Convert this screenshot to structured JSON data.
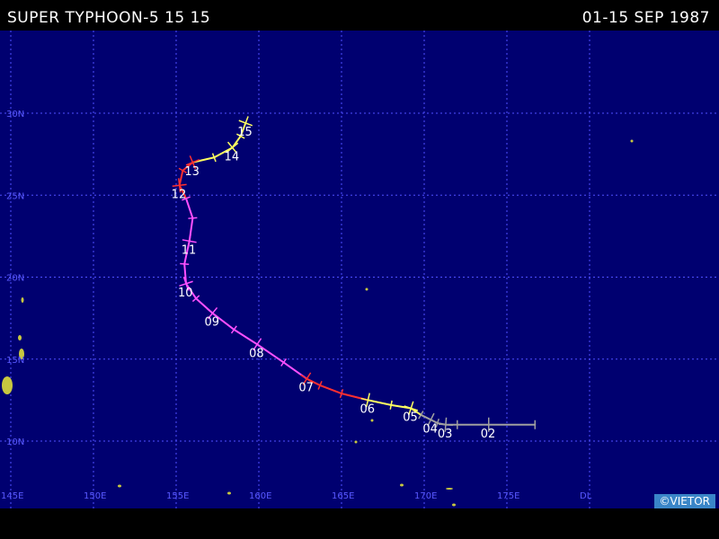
{
  "header": {
    "title": "SUPER TYPHOON-5 15 15",
    "date_range": "01-15 SEP 1987"
  },
  "map": {
    "ocean_color": "#000070",
    "grid_color": "#4f4fff",
    "label_color": "#5a5aff",
    "lat_labels": [
      {
        "text": "10N",
        "lat": 10
      },
      {
        "text": "15N",
        "lat": 15
      },
      {
        "text": "20N",
        "lat": 20
      },
      {
        "text": "25N",
        "lat": 25
      },
      {
        "text": "30N",
        "lat": 30
      }
    ],
    "lon_labels": [
      {
        "text": "145E",
        "lon": 145
      },
      {
        "text": "150E",
        "lon": 150
      },
      {
        "text": "155E",
        "lon": 155
      },
      {
        "text": "160E",
        "lon": 160
      },
      {
        "text": "165E",
        "lon": 165
      },
      {
        "text": "170E",
        "lon": 170
      },
      {
        "text": "175E",
        "lon": 175
      },
      {
        "text": "DL",
        "lon": 180
      }
    ]
  },
  "track": {
    "stage_colors": {
      "depression": "#a0a0a0",
      "storm": "#ffff60",
      "typhoon": "#ff3030",
      "super_typhoon": "#ff50ff"
    },
    "points": [
      {
        "lon": 176.7,
        "lat": 11.0,
        "stage": "depression"
      },
      {
        "lon": 173.9,
        "lat": 11.0,
        "stage": "depression",
        "day": "02"
      },
      {
        "lon": 172.0,
        "lat": 11.0,
        "stage": "depression"
      },
      {
        "lon": 171.3,
        "lat": 11.0,
        "stage": "depression",
        "day": "03"
      },
      {
        "lon": 170.8,
        "lat": 11.1,
        "stage": "depression"
      },
      {
        "lon": 170.4,
        "lat": 11.3,
        "stage": "depression",
        "day": "04"
      },
      {
        "lon": 169.8,
        "lat": 11.6,
        "stage": "depression"
      },
      {
        "lon": 169.2,
        "lat": 12.0,
        "stage": "storm",
        "day": "05"
      },
      {
        "lon": 168.0,
        "lat": 12.2,
        "stage": "storm"
      },
      {
        "lon": 166.6,
        "lat": 12.5,
        "stage": "storm",
        "day": "06"
      },
      {
        "lon": 165.0,
        "lat": 12.9,
        "stage": "typhoon"
      },
      {
        "lon": 163.7,
        "lat": 13.4,
        "stage": "typhoon"
      },
      {
        "lon": 162.9,
        "lat": 13.8,
        "stage": "typhoon",
        "day": "07"
      },
      {
        "lon": 161.5,
        "lat": 14.8,
        "stage": "super_typhoon"
      },
      {
        "lon": 159.9,
        "lat": 15.9,
        "stage": "super_typhoon",
        "day": "08"
      },
      {
        "lon": 158.5,
        "lat": 16.8,
        "stage": "super_typhoon"
      },
      {
        "lon": 157.2,
        "lat": 17.8,
        "stage": "super_typhoon",
        "day": "09"
      },
      {
        "lon": 156.2,
        "lat": 18.7,
        "stage": "super_typhoon"
      },
      {
        "lon": 155.6,
        "lat": 19.6,
        "stage": "super_typhoon",
        "day": "10"
      },
      {
        "lon": 155.5,
        "lat": 20.8,
        "stage": "super_typhoon"
      },
      {
        "lon": 155.8,
        "lat": 22.2,
        "stage": "super_typhoon",
        "day": "11"
      },
      {
        "lon": 156.0,
        "lat": 23.6,
        "stage": "super_typhoon"
      },
      {
        "lon": 155.6,
        "lat": 24.8,
        "stage": "super_typhoon"
      },
      {
        "lon": 155.2,
        "lat": 25.6,
        "stage": "typhoon",
        "day": "12"
      },
      {
        "lon": 155.4,
        "lat": 26.5,
        "stage": "typhoon"
      },
      {
        "lon": 156.0,
        "lat": 27.0,
        "stage": "typhoon",
        "day": "13"
      },
      {
        "lon": 157.3,
        "lat": 27.3,
        "stage": "storm"
      },
      {
        "lon": 158.4,
        "lat": 27.9,
        "stage": "storm",
        "day": "14"
      },
      {
        "lon": 158.9,
        "lat": 28.6,
        "stage": "storm"
      },
      {
        "lon": 159.2,
        "lat": 29.4,
        "stage": "storm",
        "day": "15"
      }
    ]
  },
  "footer": {
    "watermark": "©VIETOR"
  }
}
